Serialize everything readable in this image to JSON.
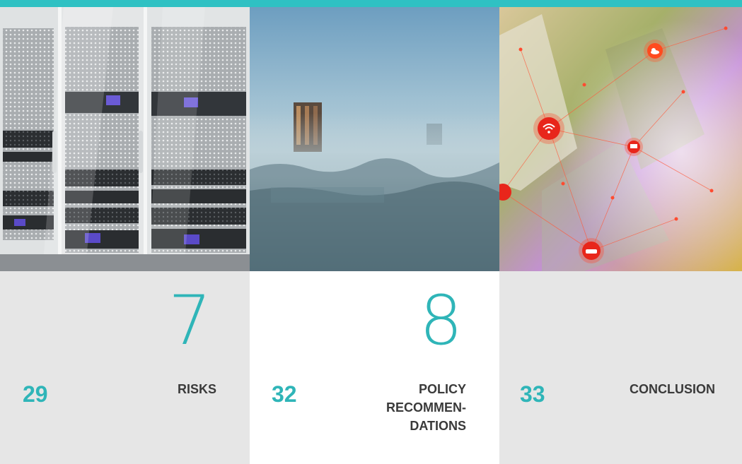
{
  "colors": {
    "accent": "#2fc1c3",
    "number_text": "#2fb5b8",
    "title_text": "#3a3a3a",
    "panel_grey": "#e6e6e6",
    "panel_white": "#ffffff"
  },
  "sections": [
    {
      "chapter_number": "7",
      "page_number": "29",
      "title": "RISKS",
      "image": "server-racks-photo"
    },
    {
      "chapter_number": "8",
      "page_number": "32",
      "title": "POLICY\nRECOMMEN-\nDATIONS",
      "image": "foggy-city-photo"
    },
    {
      "chapter_number": "",
      "page_number": "33",
      "title": "CONCLUSION",
      "image": "smart-city-network-photo"
    }
  ]
}
